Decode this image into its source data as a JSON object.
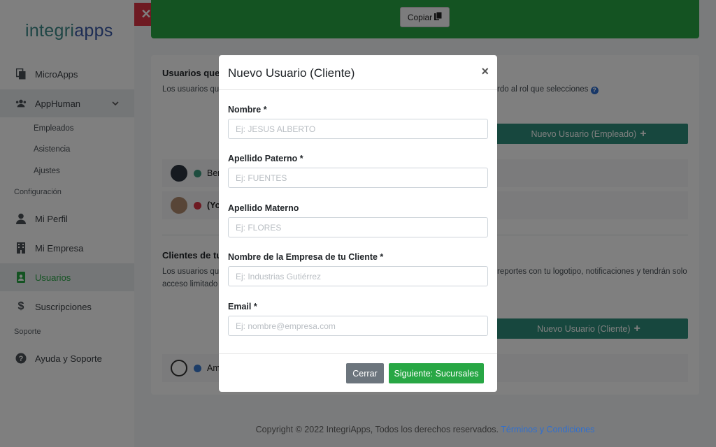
{
  "sidebar": {
    "logo_part1": "integri",
    "logo_part2": "apps",
    "items": {
      "microapps": {
        "label": "MicroApps",
        "icon": "file-copy-icon"
      },
      "apphuman": {
        "label": "AppHuman",
        "icon": "users-icon"
      },
      "empleados": {
        "label": "Empleados"
      },
      "asistencia": {
        "label": "Asistencia"
      },
      "ajustes": {
        "label": "Ajustes"
      },
      "mi_perfil": {
        "label": "Mi Perfil",
        "icon": "user-icon"
      },
      "mi_empresa": {
        "label": "Mi Empresa",
        "icon": "building-icon"
      },
      "usuarios": {
        "label": "Usuarios",
        "icon": "id-badge-icon"
      },
      "suscripciones": {
        "label": "Suscripciones",
        "icon": "dollar-icon"
      },
      "ayuda": {
        "label": "Ayuda y Soporte",
        "icon": "question-icon"
      }
    },
    "sections": {
      "configuracion": "Configuración",
      "soporte": "Soporte"
    }
  },
  "top": {
    "copy_label": "Copiar"
  },
  "main": {
    "usuarios_title": "Usuarios que",
    "usuarios_text_left": "Los usuarios qu",
    "usuarios_text_right": "rdo al rol que selecciones",
    "new_employee_label": "Nuevo Usuario (Empleado)",
    "user_rows": [
      {
        "name": "Ber",
        "status_color": "#3d9a7e"
      },
      {
        "name": "(Yo",
        "status_color": "#dc3545"
      }
    ],
    "clientes_title": "Clientes de tu",
    "clientes_text_left1": "Los usuarios que",
    "clientes_text_left2": "acceso limitado",
    "clientes_text_right": "reportes con tu logotipo, notificaciones y tendrán solo",
    "new_client_label": "Nuevo Usuario (Cliente)",
    "client_rows": [
      {
        "name": "Am",
        "status_color": "#3b7bd0"
      }
    ]
  },
  "footer": {
    "copyright": "Copyright © 2022 IntegriApps, Todos los derechos reservados.",
    "terms": "Términos y Condiciones"
  },
  "modal": {
    "title": "Nuevo Usuario (Cliente)",
    "fields": [
      {
        "label": "Nombre *",
        "placeholder": "Ej: JESUS ALBERTO"
      },
      {
        "label": "Apellido Paterno *",
        "placeholder": "Ej: FUENTES"
      },
      {
        "label": "Apellido Materno",
        "placeholder": "Ej: FLORES"
      },
      {
        "label": "Nombre de la Empresa de tu Cliente *",
        "placeholder": "Ej: Industrias Gutiérrez"
      },
      {
        "label": "Email *",
        "placeholder": "Ej: nombre@empresa.com"
      }
    ],
    "cancel_label": "Cerrar",
    "next_label": "Siguiente: Sucursales"
  },
  "colors": {
    "brand_green": "#28a745",
    "teal": "#2f8f7c",
    "danger": "#dc3545",
    "link": "#2f6fd0"
  }
}
